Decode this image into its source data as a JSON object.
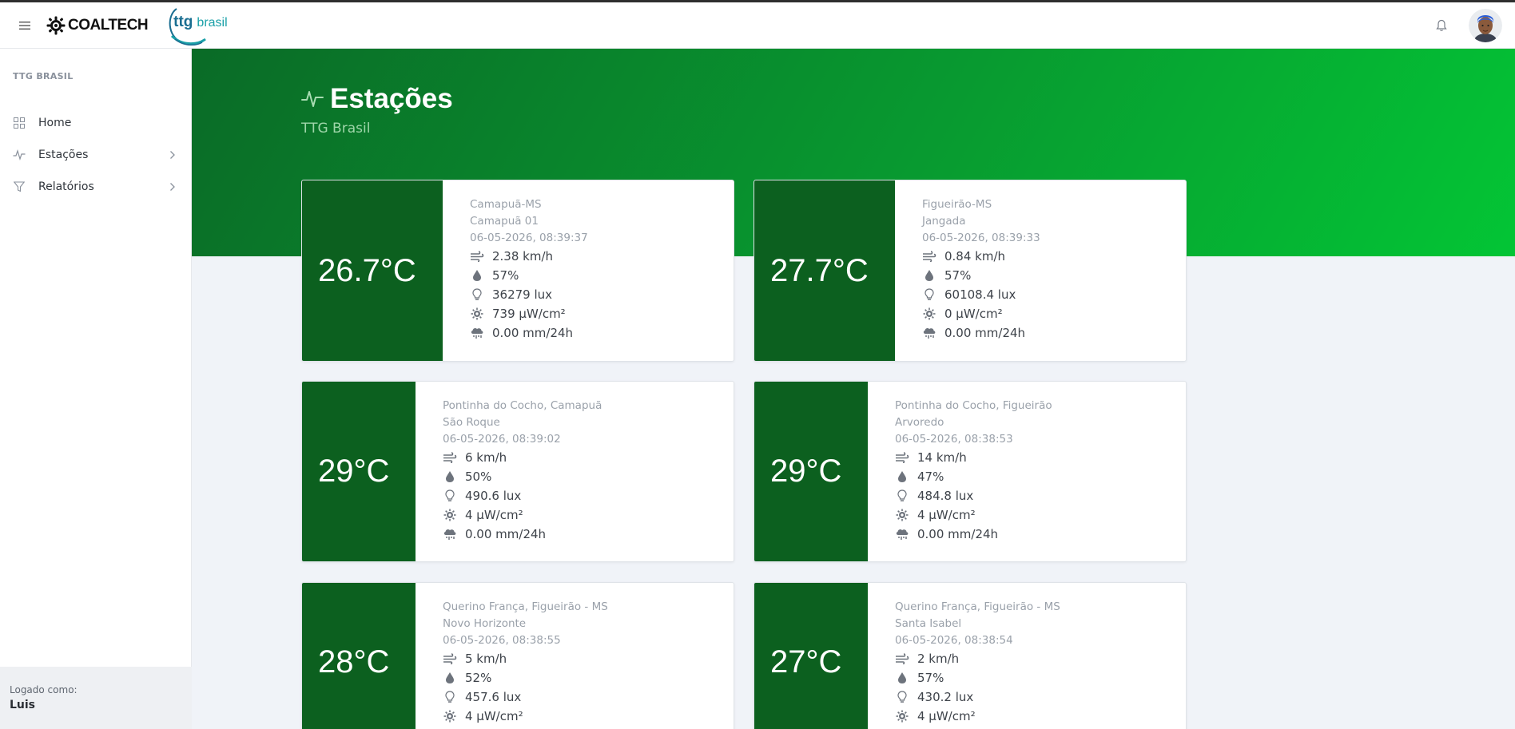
{
  "header": {
    "brand_name": "COALTECH",
    "partner_name_a": "ttg",
    "partner_name_b": "brasil"
  },
  "sidebar": {
    "section_title": "TTG BRASIL",
    "items": [
      {
        "label": "Home",
        "icon": "grid-icon"
      },
      {
        "label": "Estações",
        "icon": "activity-icon"
      },
      {
        "label": "Relatórios",
        "icon": "filter-icon"
      }
    ],
    "footer": {
      "label": "Logado como:",
      "user": "Luis"
    }
  },
  "page": {
    "title": "Estações",
    "subtitle": "TTG Brasil"
  },
  "colors": {
    "primary_green": "#0c601f",
    "hero_start": "#0a6b27",
    "hero_end": "#03c535"
  },
  "stations": [
    {
      "temp": "26.7°C",
      "location": "Camapuã-MS",
      "name": "Camapuã 01",
      "datetime": "06-05-2026, 08:39:37",
      "wind": "2.38 km/h",
      "humidity": "57%",
      "light": "36279 lux",
      "uv": "739 µW/cm²",
      "rain": "0.00 mm/24h"
    },
    {
      "temp": "27.7°C",
      "location": "Figueirão-MS",
      "name": "Jangada",
      "datetime": "06-05-2026, 08:39:33",
      "wind": "0.84 km/h",
      "humidity": "57%",
      "light": "60108.4 lux",
      "uv": "0 µW/cm²",
      "rain": "0.00 mm/24h"
    },
    {
      "temp": "29°C",
      "location": "Pontinha do Cocho, Camapuã",
      "name": "São Roque",
      "datetime": "06-05-2026, 08:39:02",
      "wind": "6 km/h",
      "humidity": "50%",
      "light": "490.6 lux",
      "uv": "4 µW/cm²",
      "rain": "0.00 mm/24h"
    },
    {
      "temp": "29°C",
      "location": "Pontinha do Cocho, Figueirão",
      "name": "Arvoredo",
      "datetime": "06-05-2026, 08:38:53",
      "wind": "14 km/h",
      "humidity": "47%",
      "light": "484.8 lux",
      "uv": "4 µW/cm²",
      "rain": "0.00 mm/24h"
    },
    {
      "temp": "28°C",
      "location": "Querino França, Figueirão - MS",
      "name": "Novo Horizonte",
      "datetime": "06-05-2026, 08:38:55",
      "wind": "5 km/h",
      "humidity": "52%",
      "light": "457.6 lux",
      "uv": "4 µW/cm²",
      "rain": ""
    },
    {
      "temp": "27°C",
      "location": "Querino França, Figueirão - MS",
      "name": "Santa Isabel",
      "datetime": "06-05-2026, 08:38:54",
      "wind": "2 km/h",
      "humidity": "57%",
      "light": "430.2 lux",
      "uv": "4 µW/cm²",
      "rain": ""
    }
  ]
}
